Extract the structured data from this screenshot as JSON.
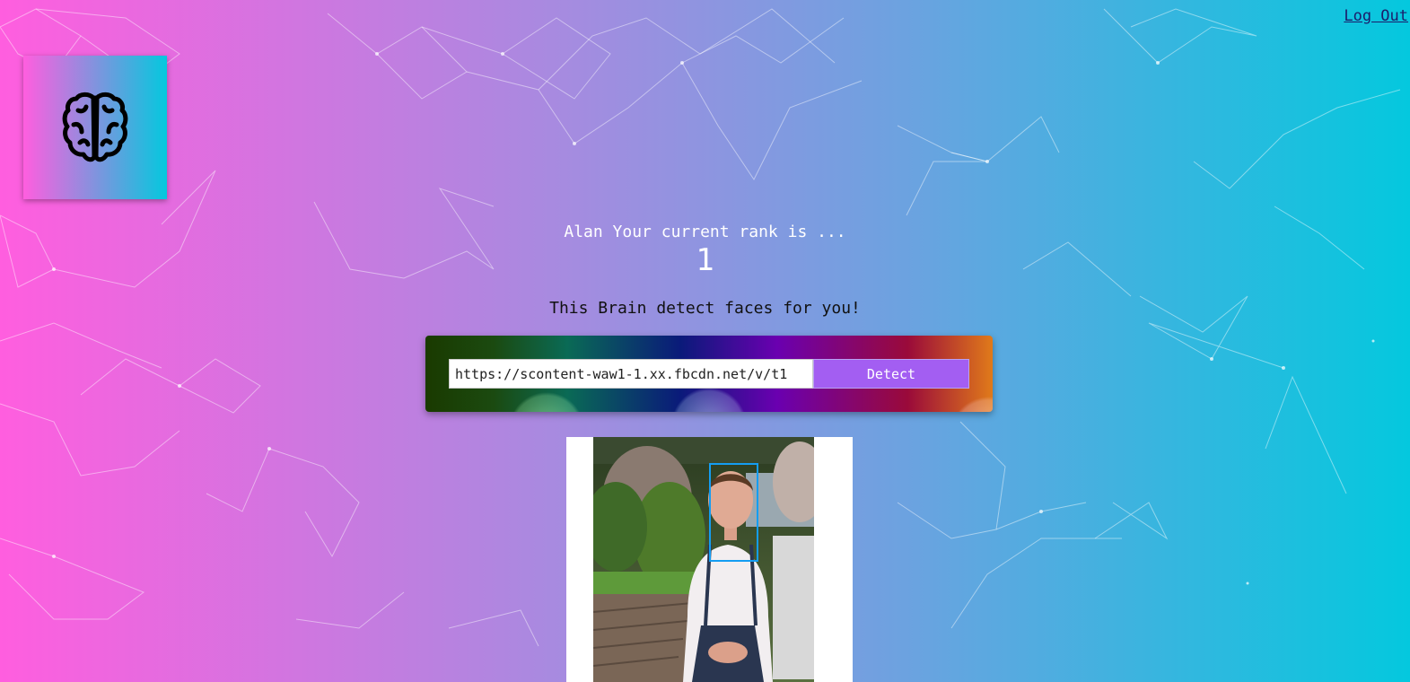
{
  "header": {
    "logout_label": "Log Out"
  },
  "logo": {
    "icon": "brain-icon"
  },
  "rank": {
    "text": "Alan Your current rank is ...",
    "value": "1"
  },
  "intro": {
    "text": "This Brain detect faces for you!"
  },
  "form": {
    "url_value": "https://scontent-waw1-1.xx.fbcdn.net/v/t1",
    "detect_label": "Detect"
  },
  "result": {
    "image": "detected-face-photo",
    "face_count": 1,
    "box_color": "#149df2"
  },
  "colors": {
    "gradient_start": "#ff5edf",
    "gradient_end": "#04c8de",
    "detect_button": "#a35ef2"
  }
}
